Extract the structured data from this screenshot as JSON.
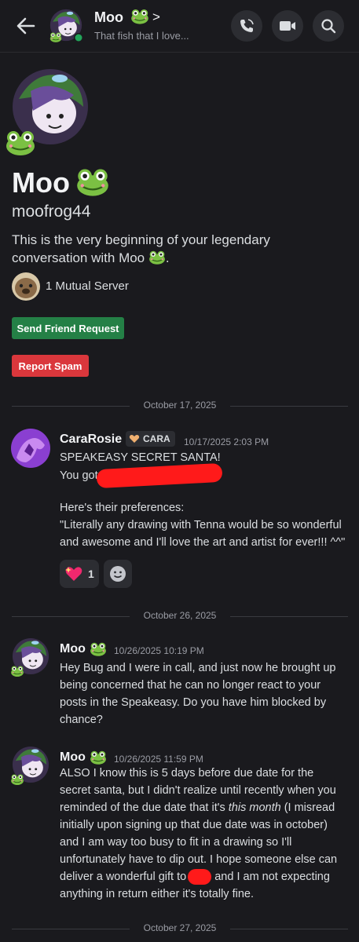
{
  "header": {
    "name": "Moo",
    "status": "That fish that I love...",
    "chevron": ">"
  },
  "profile": {
    "name": "Moo",
    "username": "moofrog44",
    "intro": "This is the very beginning of your legendary conversation with Moo",
    "mutual_servers": "1 Mutual Server",
    "friend_button": "Send Friend Request",
    "spam_button": "Report Spam"
  },
  "dividers": [
    "October 17, 2025",
    "October 26, 2025",
    "October 27, 2025"
  ],
  "messages": [
    {
      "author": "CaraRosie",
      "tag": "CARA",
      "timestamp": "10/17/2025 2:03 PM",
      "line1": "SPEAKEASY SECRET SANTA!",
      "line2": "You got:",
      "line3": "Here's their preferences:",
      "line4": "\"Literally any drawing with Tenna would be so wonderful and awesome and I'll love the art and artist for ever!!! ^^\"",
      "reaction_count": "1"
    },
    {
      "author": "Moo",
      "timestamp": "10/26/2025 10:19 PM",
      "text": "Hey Bug and I were in call, and just now he brought up being concerned that he can no longer react to your posts in the Speakeasy. Do you have him blocked by chance?"
    },
    {
      "author": "Moo",
      "timestamp": "10/26/2025 11:59 PM",
      "text_a": "ALSO I know this is 5 days before due date for the secret santa, but I didn't realize until recently when you reminded of the due date that it's ",
      "text_em": "this month",
      "text_b": " (I misread initially upon signing up that due date was in october) and I am way too busy to fit in a drawing so I'll unfortunately have to dip out. I hope someone else can deliver a wonderful gift to",
      "text_c": " and I am not expecting anything in return either it's totally fine."
    }
  ],
  "colors": {
    "background": "#1a1a1e",
    "green_button": "#248046",
    "red_button": "#da373c",
    "online_status": "#23a55a",
    "redaction": "#ff1a1a"
  }
}
